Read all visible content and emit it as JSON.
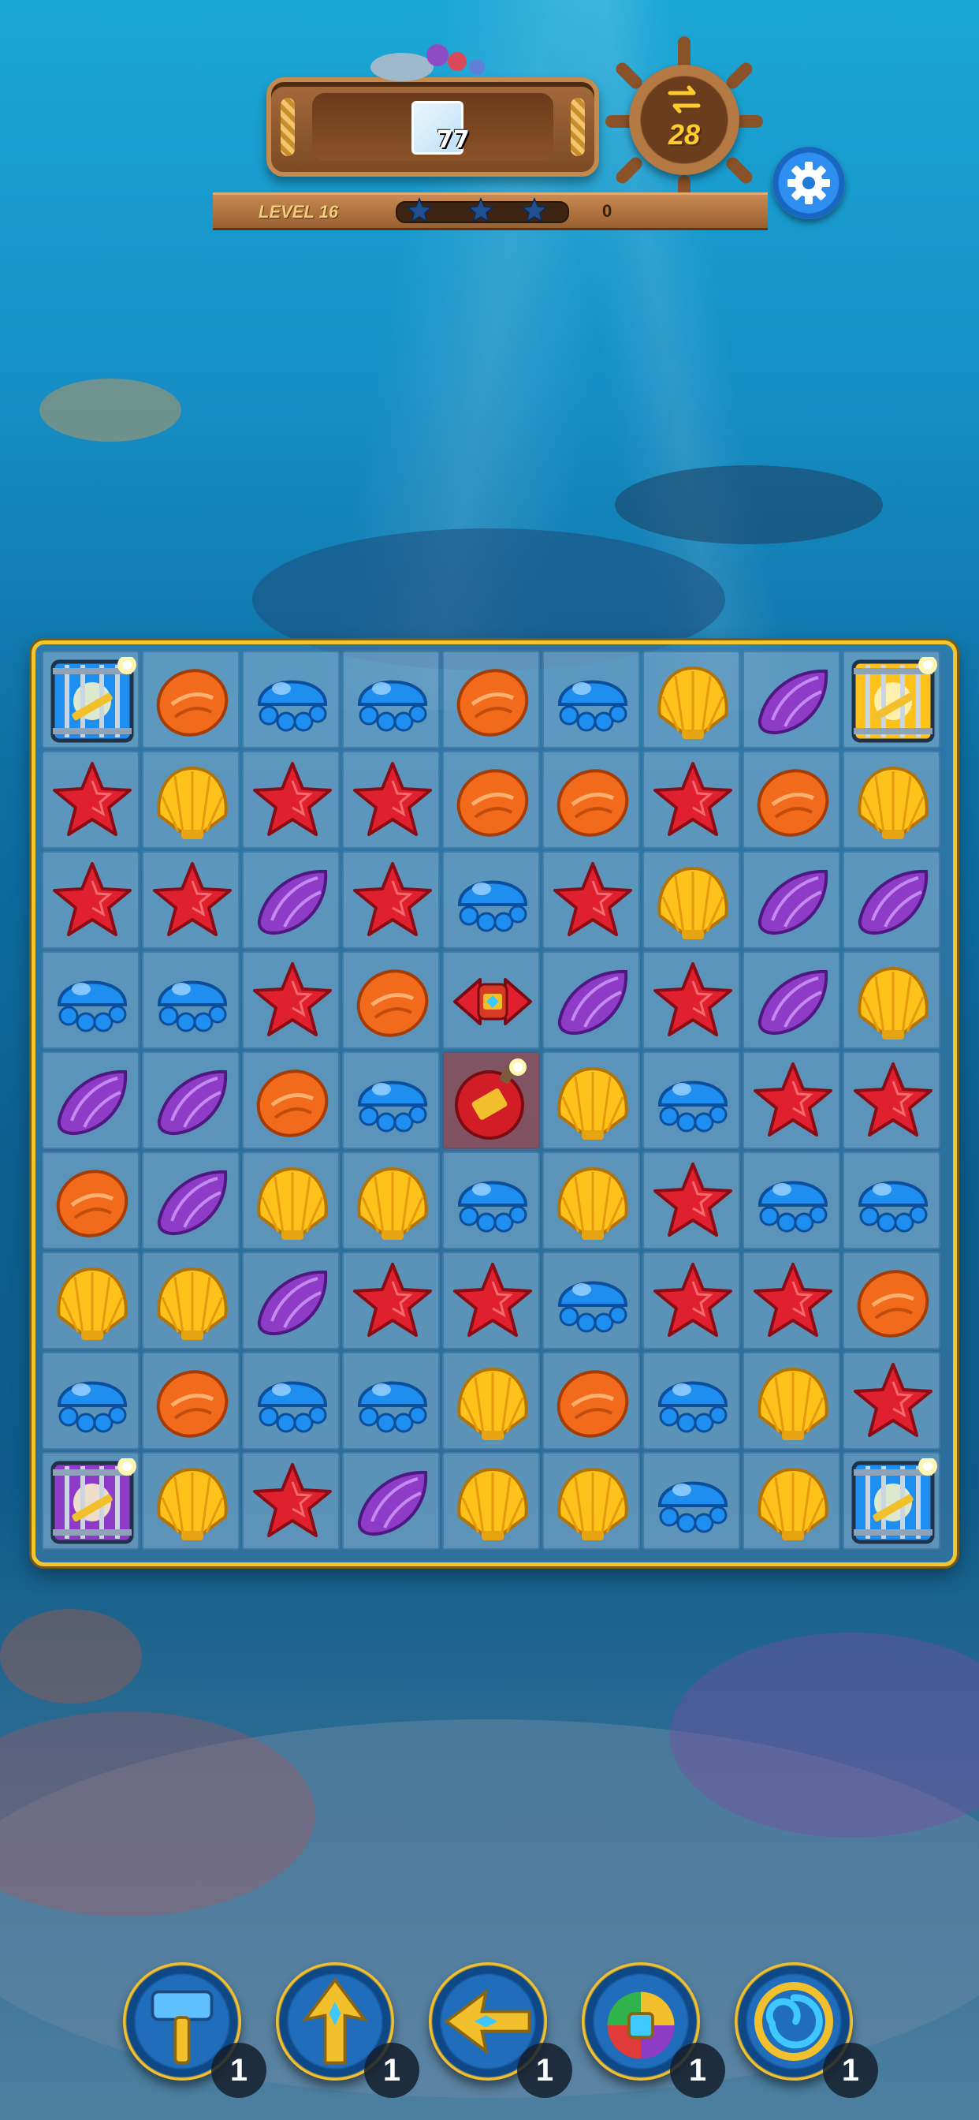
{
  "header": {
    "goal_count": "77",
    "moves": "28",
    "level_label": "LEVEL 16",
    "score": "0",
    "stars": 3
  },
  "board": {
    "columns": 9,
    "rows": 9,
    "grid": [
      [
        "cage-blue",
        "shell-orange",
        "jelly-blue",
        "jelly-blue",
        "shell-orange",
        "jelly-blue",
        "scallop-yellow",
        "conch-purple",
        "cage-yellow"
      ],
      [
        "star-red",
        "scallop-yellow",
        "star-red",
        "star-red",
        "shell-orange",
        "shell-orange",
        "star-red",
        "shell-orange",
        "scallop-yellow"
      ],
      [
        "star-red",
        "star-red",
        "conch-purple",
        "star-red",
        "jelly-blue",
        "star-red",
        "scallop-yellow",
        "conch-purple",
        "conch-purple"
      ],
      [
        "jelly-blue",
        "jelly-blue",
        "star-red",
        "shell-orange",
        "rocket-red",
        "conch-purple",
        "star-red",
        "conch-purple",
        "scallop-yellow"
      ],
      [
        "conch-purple",
        "conch-purple",
        "shell-orange",
        "jelly-blue",
        "bomb-red",
        "scallop-yellow",
        "jelly-blue",
        "star-red",
        "star-red"
      ],
      [
        "shell-orange",
        "conch-purple",
        "scallop-yellow",
        "scallop-yellow",
        "jelly-blue",
        "scallop-yellow",
        "star-red",
        "jelly-blue",
        "jelly-blue"
      ],
      [
        "scallop-yellow",
        "scallop-yellow",
        "conch-purple",
        "star-red",
        "star-red",
        "jelly-blue",
        "star-red",
        "star-red",
        "shell-orange"
      ],
      [
        "jelly-blue",
        "shell-orange",
        "jelly-blue",
        "jelly-blue",
        "scallop-yellow",
        "shell-orange",
        "jelly-blue",
        "scallop-yellow",
        "star-red"
      ],
      [
        "cage-purple",
        "scallop-yellow",
        "star-red",
        "conch-purple",
        "scallop-yellow",
        "scallop-yellow",
        "jelly-blue",
        "scallop-yellow",
        "cage-blue"
      ]
    ],
    "highlighted": [
      [
        4,
        4
      ]
    ]
  },
  "boosters": [
    {
      "icon": "hammer-icon",
      "count": "1"
    },
    {
      "icon": "vertical-arrow-icon",
      "count": "1"
    },
    {
      "icon": "horizontal-arrow-icon",
      "count": "1"
    },
    {
      "icon": "rainbow-bomb-icon",
      "count": "1"
    },
    {
      "icon": "whirlpool-icon",
      "count": "1"
    }
  ],
  "colors": {
    "red": "#e0202e",
    "orange": "#f26a1b",
    "yellow": "#ffc21a",
    "blue": "#1e8ff0",
    "purple": "#8e3cc8",
    "board_border": "#f3c62f"
  }
}
